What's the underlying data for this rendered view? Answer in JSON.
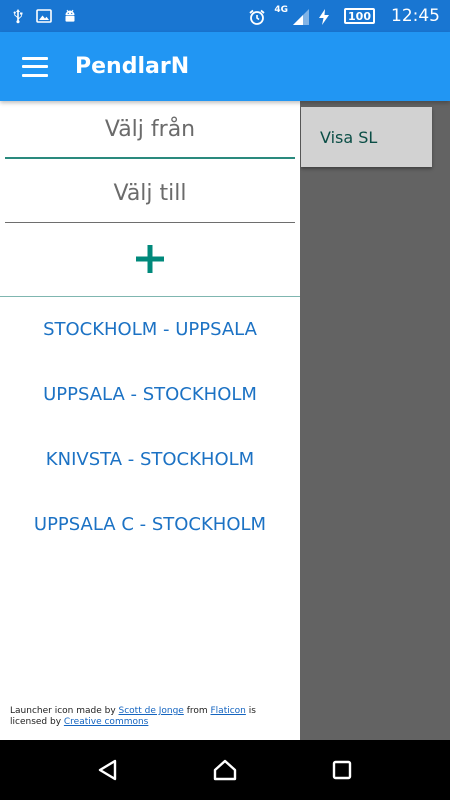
{
  "status_bar": {
    "network": "4G",
    "battery": "100",
    "time": "12:45"
  },
  "app_bar": {
    "title": "PendlarN"
  },
  "drawer": {
    "from_placeholder": "Välj från",
    "to_placeholder": "Välj till",
    "add_symbol": "+",
    "routes": [
      "STOCKHOLM - UPPSALA",
      "UPPSALA - STOCKHOLM",
      "KNIVSTA - STOCKHOLM",
      "UPPSALA C - STOCKHOLM"
    ],
    "credits": {
      "prefix": "Launcher icon made by ",
      "author": "Scott de Jonge",
      "middle": " from ",
      "source": "Flaticon",
      "middle2": " is licensed by ",
      "license": "Creative commons"
    }
  },
  "main": {
    "visa_button": "Visa SL"
  },
  "colors": {
    "status_bar": "#1976d2",
    "app_bar": "#2196f3",
    "accent_teal": "#00897b",
    "route_text": "#1c72c4",
    "scrim": "#636363"
  }
}
